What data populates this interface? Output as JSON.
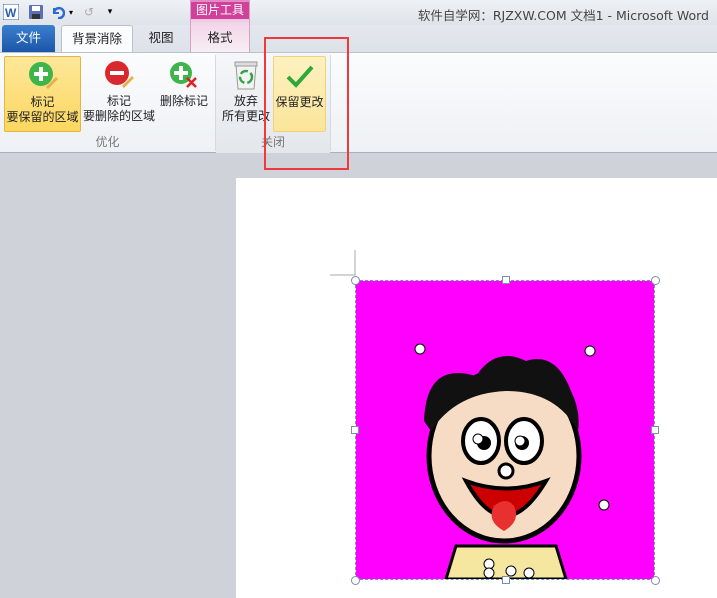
{
  "title_bar": {
    "title": "软件自学网：RJZXW.COM 文档1 - Microsoft Word",
    "contextual_tab_group": "图片工具"
  },
  "tabs": [
    {
      "label": "文件"
    },
    {
      "label": "背景消除",
      "active": true
    },
    {
      "label": "视图"
    },
    {
      "label": "格式"
    }
  ],
  "ribbon": {
    "buttons": [
      {
        "line1": "标记",
        "line2": "要保留的区域",
        "icon": "plus-pencil-icon",
        "selected": true
      },
      {
        "line1": "标记",
        "line2": "要删除的区域",
        "icon": "minus-pencil-icon"
      },
      {
        "line1": "删除标记",
        "icon": "delete-mark-icon"
      },
      {
        "line1": "放弃",
        "line2": "所有更改",
        "icon": "recycle-bin-icon"
      },
      {
        "line1": "保留更改",
        "icon": "checkmark-icon",
        "highlighted": true
      }
    ],
    "groups": [
      {
        "label": "优化"
      },
      {
        "label": "关闭"
      }
    ]
  },
  "colors": {
    "background_removal": "#ff00ff",
    "highlight_box": "#f0393a",
    "file_tab": "#2a66b8"
  }
}
